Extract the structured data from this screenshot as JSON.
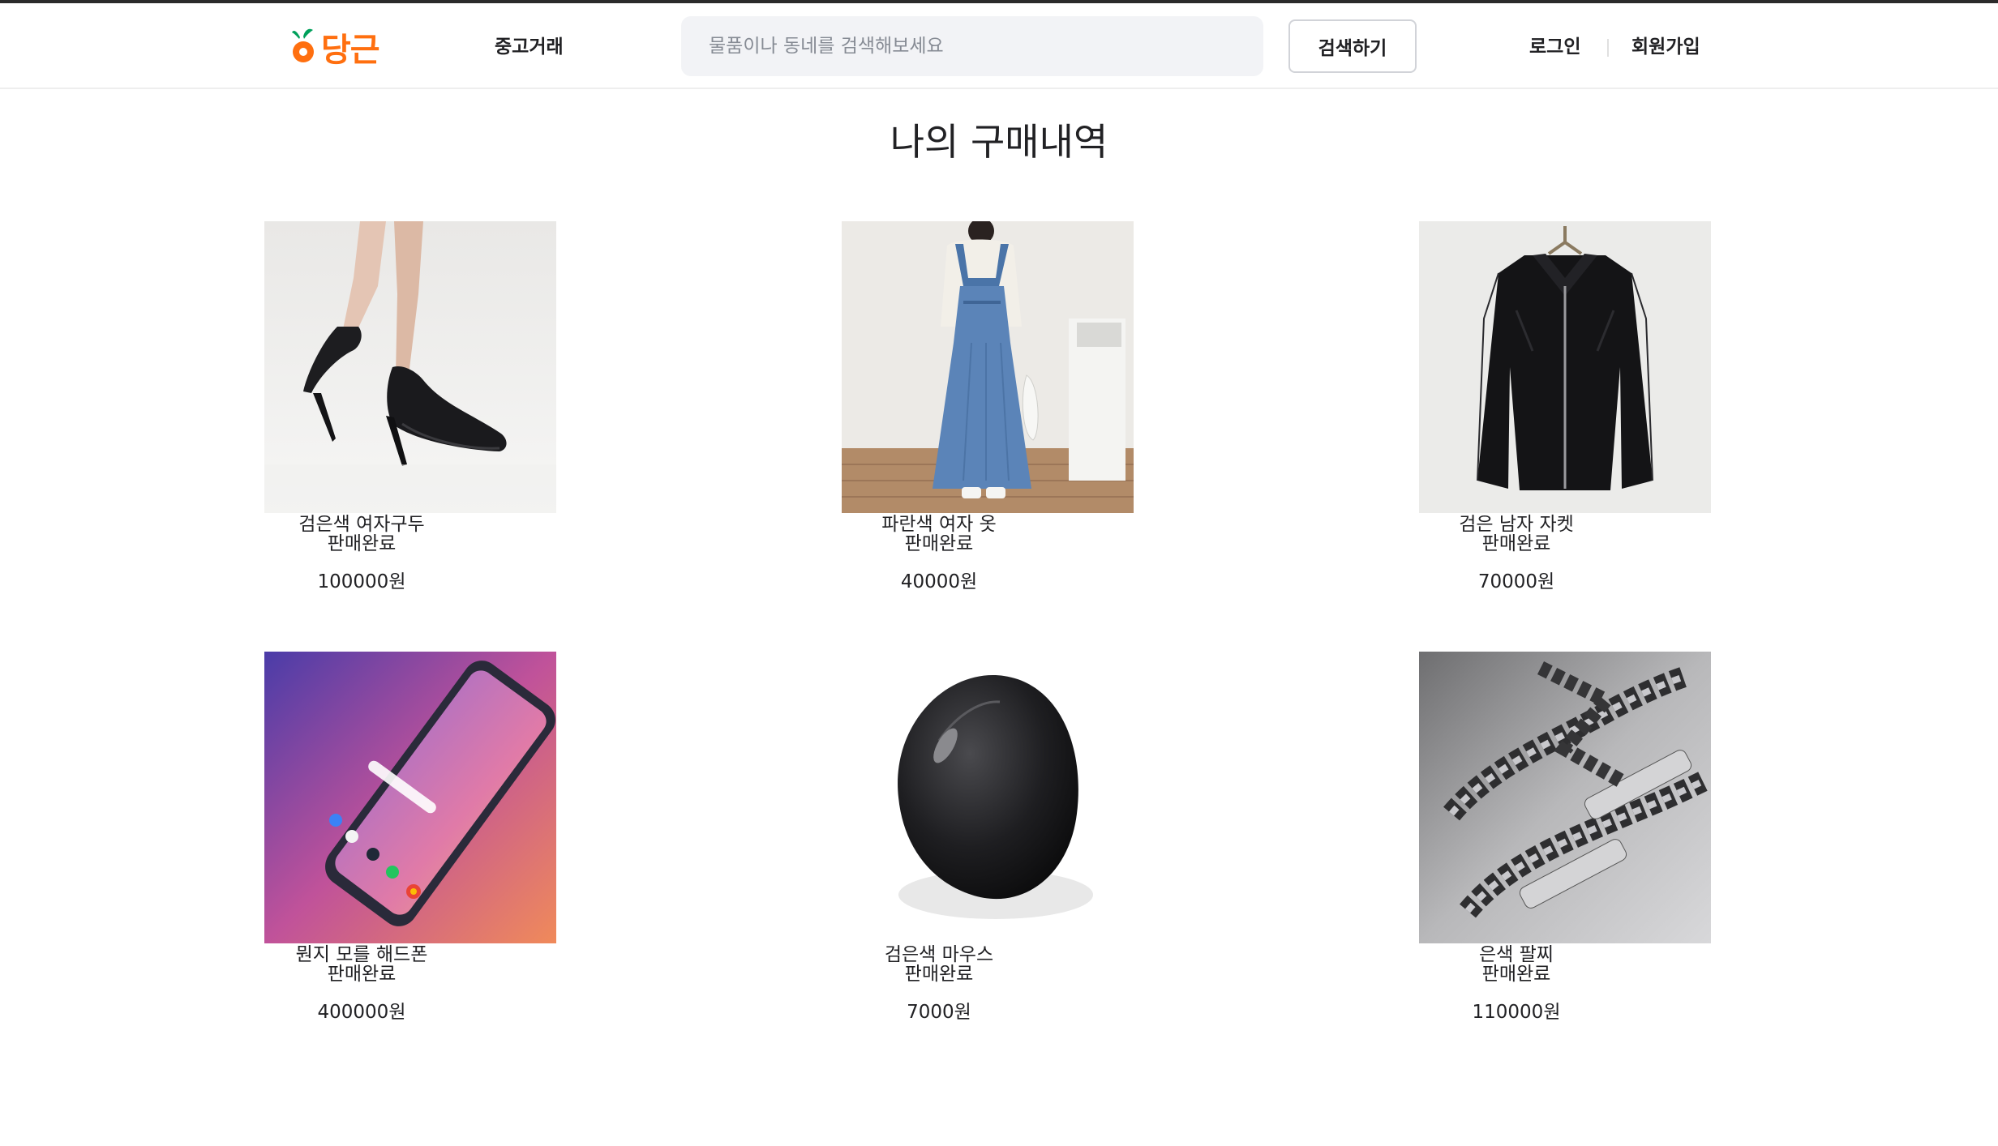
{
  "header": {
    "logo_text": "당근",
    "nav_label": "중고거래",
    "search_placeholder": "물품이나 동네를 검색해보세요",
    "search_button": "검색하기",
    "login": "로그인",
    "signup": "회원가입",
    "brand_color": "#ff6f0f"
  },
  "page_title": "나의 구매내역",
  "products": [
    {
      "name": "검은색 여자구두",
      "status": "판매완료",
      "price": "100000원",
      "image": "black-heels"
    },
    {
      "name": "파란색 여자 옷",
      "status": "판매완료",
      "price": "40000원",
      "image": "blue-denim-dress"
    },
    {
      "name": "검은 남자 자켓",
      "status": "판매완료",
      "price": "70000원",
      "image": "black-leather-jacket"
    },
    {
      "name": "뭔지 모를 해드폰",
      "status": "판매완료",
      "price": "400000원",
      "image": "smartphone"
    },
    {
      "name": "검은색 마우스",
      "status": "판매완료",
      "price": "7000원",
      "image": "black-mouse"
    },
    {
      "name": "은색 팔찌",
      "status": "판매완료",
      "price": "110000원",
      "image": "silver-bracelet"
    }
  ]
}
